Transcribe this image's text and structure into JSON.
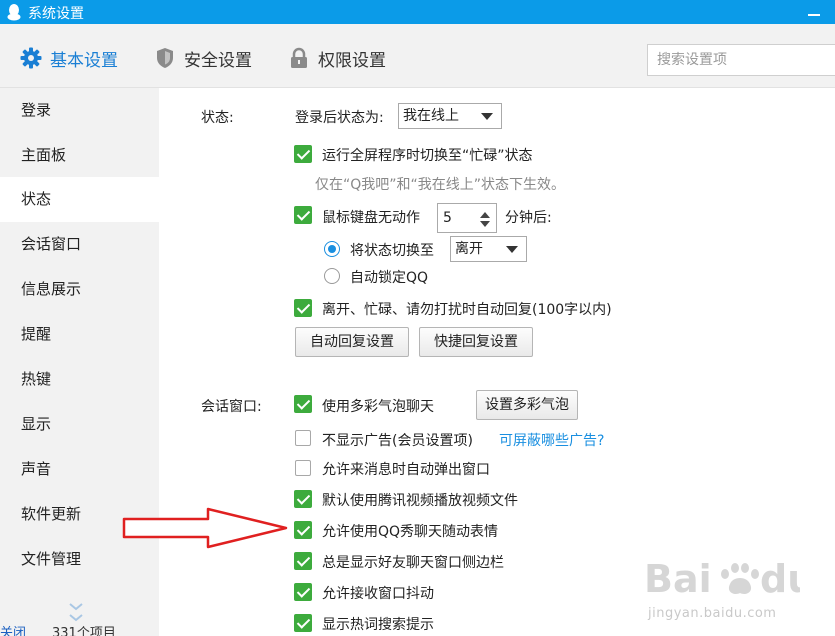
{
  "window": {
    "title": "系统设置"
  },
  "top_tabs": [
    {
      "label": "基本设置",
      "icon": "gear-icon",
      "active": true
    },
    {
      "label": "安全设置",
      "icon": "shield-icon",
      "active": false
    },
    {
      "label": "权限设置",
      "icon": "lock-icon",
      "active": false
    }
  ],
  "search": {
    "placeholder": "搜索设置项"
  },
  "sidebar": {
    "items": [
      {
        "label": "登录"
      },
      {
        "label": "主面板"
      },
      {
        "label": "状态",
        "active": true
      },
      {
        "label": "会话窗口"
      },
      {
        "label": "信息展示"
      },
      {
        "label": "提醒"
      },
      {
        "label": "热键"
      },
      {
        "label": "显示"
      },
      {
        "label": "声音"
      },
      {
        "label": "软件更新"
      },
      {
        "label": "文件管理"
      }
    ]
  },
  "status_section": {
    "heading": "状态:",
    "login_status_label": "登录后状态为:",
    "login_status_value": "我在线上",
    "fullscreen_busy": {
      "label": "运行全屏程序时切换至“忙碌”状态",
      "checked": true
    },
    "fullscreen_hint": "仅在“Q我吧”和“我在线上”状态下生效。",
    "idle": {
      "label": "鼠标键盘无动作",
      "checked": true,
      "minutes": "5",
      "suffix": "分钟后:"
    },
    "switch_status": {
      "label": "将状态切换至",
      "selected": true,
      "value": "离开"
    },
    "auto_lock": {
      "label": "自动锁定QQ",
      "selected": false
    },
    "auto_reply": {
      "label": "离开、忙碌、请勿打扰时自动回复(100字以内)",
      "checked": true
    },
    "auto_reply_button": "自动回复设置",
    "quick_reply_button": "快捷回复设置"
  },
  "chat_section": {
    "heading": "会话窗口:",
    "options": [
      {
        "label": "使用多彩气泡聊天",
        "checked": true
      },
      {
        "label": "不显示广告(会员设置项)",
        "checked": false
      },
      {
        "label": "允许来消息时自动弹出窗口",
        "checked": false
      },
      {
        "label": "默认使用腾讯视频播放视频文件",
        "checked": true
      },
      {
        "label": "允许使用QQ秀聊天随动表情",
        "checked": true
      },
      {
        "label": "总是显示好友聊天窗口侧边栏",
        "checked": true
      },
      {
        "label": "允许接收窗口抖动",
        "checked": true
      },
      {
        "label": "显示热词搜索提示",
        "checked": true
      }
    ],
    "bubble_button": "设置多彩气泡",
    "ads_link": "可屏蔽哪些广告?"
  },
  "watermark": {
    "text": "jingyan.baidu.com",
    "logo_text": "Bai du"
  },
  "bottom_strip": {
    "left": "关闭",
    "right": "331个项目"
  },
  "colors": {
    "accent": "#1a8fe0",
    "titlebar": "#0b9be8",
    "check_green": "#3dab3d",
    "arrow_red": "#e02020"
  }
}
